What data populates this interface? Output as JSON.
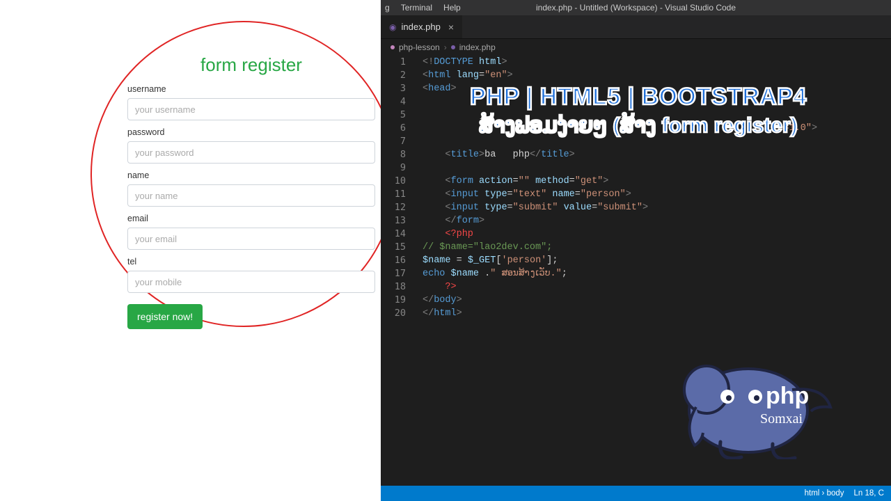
{
  "form": {
    "title": "form register",
    "fields": [
      {
        "label": "username",
        "placeholder": "your username"
      },
      {
        "label": "password",
        "placeholder": "your password"
      },
      {
        "label": "name",
        "placeholder": "your name"
      },
      {
        "label": "email",
        "placeholder": "your email"
      },
      {
        "label": "tel",
        "placeholder": "your mobile"
      }
    ],
    "submit_label": "register now!"
  },
  "vscode": {
    "menu": {
      "go": "g",
      "terminal": "Terminal",
      "help": "Help"
    },
    "window_title": "index.php - Untitled (Workspace) - Visual Studio Code",
    "tab": {
      "file": "index.php"
    },
    "breadcrumb": {
      "folder": "php-lesson",
      "file": "index.php"
    },
    "status": {
      "path": "html › body",
      "pos": "Ln 18, C"
    },
    "code": [
      {
        "n": 1,
        "html": "<span class='c-gray'>&lt;!</span><span class='c-blue'>DOCTYPE</span> <span class='c-lblue'>html</span><span class='c-gray'>&gt;</span>"
      },
      {
        "n": 2,
        "html": "<span class='c-gray'>&lt;</span><span class='c-blue'>html</span> <span class='c-lblue'>lang</span>=<span class='c-str'>\"en\"</span><span class='c-gray'>&gt;</span>"
      },
      {
        "n": 3,
        "html": "<span class='c-gray'>&lt;</span><span class='c-blue'>head</span><span class='c-gray'>&gt;</span>"
      },
      {
        "n": 4,
        "html": ""
      },
      {
        "n": 5,
        "html": ""
      },
      {
        "n": 6,
        "html": "                                                              <span class='c-str'>le=1.0\"</span><span class='c-gray'>&gt;</span>"
      },
      {
        "n": 7,
        "html": ""
      },
      {
        "n": 8,
        "html": "    <span class='c-gray'>&lt;</span><span class='c-blue'>title</span><span class='c-gray'>&gt;</span>ba<span class='c-wht'>&nbsp;&nbsp;&nbsp;php</span><span class='c-gray'>&lt;/</span><span class='c-blue'>title</span><span class='c-gray'>&gt;</span>"
      },
      {
        "n": 9,
        "html": ""
      },
      {
        "n": 10,
        "html": "    <span class='c-gray'>&lt;</span><span class='c-blue'>form</span> <span class='c-lblue'>action</span>=<span class='c-str'>\"\"</span> <span class='c-lblue'>method</span>=<span class='c-str'>\"get\"</span><span class='c-gray'>&gt;</span>"
      },
      {
        "n": 11,
        "html": "    <span class='c-gray'>&lt;</span><span class='c-blue'>input</span> <span class='c-lblue'>type</span>=<span class='c-str'>\"text\"</span> <span class='c-lblue'>name</span>=<span class='c-str'>\"person\"</span><span class='c-gray'>&gt;</span>"
      },
      {
        "n": 12,
        "html": "    <span class='c-gray'>&lt;</span><span class='c-blue'>input</span> <span class='c-lblue'>type</span>=<span class='c-str'>\"submit\"</span> <span class='c-lblue'>value</span>=<span class='c-str'>\"submit\"</span><span class='c-gray'>&gt;</span>"
      },
      {
        "n": 13,
        "html": "    <span class='c-gray'>&lt;/</span><span class='c-blue'>form</span><span class='c-gray'>&gt;</span>"
      },
      {
        "n": 14,
        "html": "    <span class='c-red'>&lt;?php</span>"
      },
      {
        "n": 15,
        "html": "<span class='c-grn'>// $name=\"lao2dev.com\";</span>"
      },
      {
        "n": 16,
        "html": "<span class='c-lblue'>$name</span> <span class='c-wht'>=</span> <span class='c-lblue'>$_GET</span>[<span class='c-str'>'person'</span>];"
      },
      {
        "n": 17,
        "html": "<span class='c-blue'>echo</span> <span class='c-lblue'>$name</span> .<span class='c-str'>\" ສອນສ້າງເວັບ.\"</span>;"
      },
      {
        "n": 18,
        "html": "    <span class='c-red'>?&gt;</span>"
      },
      {
        "n": 19,
        "html": "<span class='c-gray'>&lt;/</span><span class='c-blue'>body</span><span class='c-gray'>&gt;</span>"
      },
      {
        "n": 20,
        "html": "<span class='c-gray'>&lt;/</span><span class='c-blue'>html</span><span class='c-gray'>&gt;</span>"
      }
    ]
  },
  "overlay": {
    "line1": "PHP | HTML5 | BOOTSTRAP4",
    "line2": "ສ້າງຟອມງ່າຍໆ (ສ້າງ form register)"
  },
  "logo": {
    "brand": "php",
    "signature": "Somxai"
  }
}
